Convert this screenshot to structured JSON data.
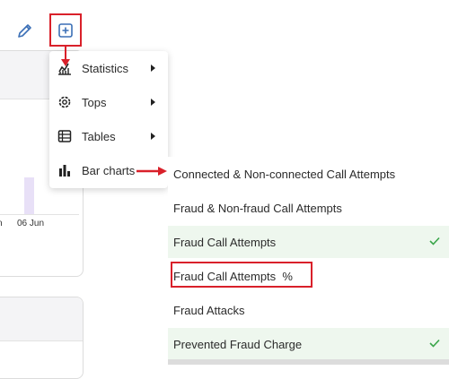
{
  "background": {
    "chart_ticks": [
      "n",
      "06 Jun"
    ]
  },
  "toolbar": {
    "edit_icon": "pencil-icon",
    "add_icon": "add-square-icon"
  },
  "menu": {
    "items": [
      {
        "label": "Statistics",
        "icon": "line-chart-icon",
        "has_submenu": true
      },
      {
        "label": "Tops",
        "icon": "gear-badge-icon",
        "has_submenu": true
      },
      {
        "label": "Tables",
        "icon": "table-icon",
        "has_submenu": true
      },
      {
        "label": "Bar charts",
        "icon": "bar-chart-icon",
        "has_submenu": false
      }
    ]
  },
  "submenu": {
    "items": [
      {
        "label": "Connected & Non-connected Call Attempts",
        "selected": false
      },
      {
        "label": "Fraud & Non-fraud Call Attempts",
        "selected": false
      },
      {
        "label": "Fraud Call Attempts",
        "selected": true
      },
      {
        "label": "Fraud Call Attempts  %",
        "selected": false
      },
      {
        "label": "Fraud Attacks",
        "selected": false
      },
      {
        "label": "Prevented Fraud Charge",
        "selected": true
      }
    ]
  },
  "colors": {
    "annotation_red": "#d9202a",
    "selected_bg": "#eef7ee",
    "check_green": "#3aa64a"
  }
}
